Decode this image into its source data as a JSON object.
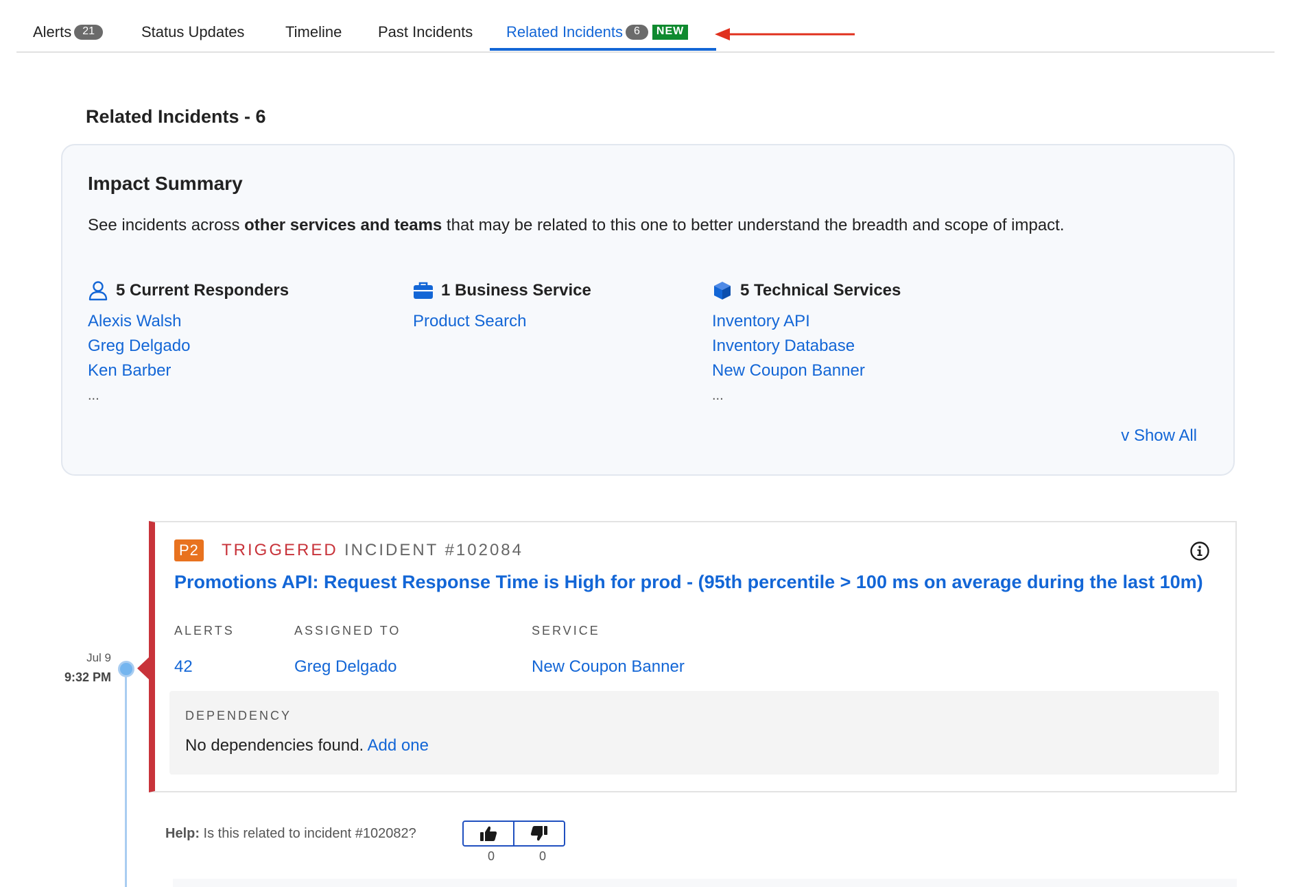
{
  "tabs": [
    {
      "label": "Alerts",
      "count": "21"
    },
    {
      "label": "Status Updates"
    },
    {
      "label": "Timeline"
    },
    {
      "label": "Past Incidents"
    },
    {
      "label": "Related Incidents",
      "count": "6",
      "badge": "NEW",
      "active": true
    }
  ],
  "colors": {
    "accent": "#1366d6",
    "triggered": "#c8333a",
    "priority": "#e8721f",
    "new_badge": "#0f8a2f",
    "annotation_arrow": "#e0301e"
  },
  "section": {
    "heading": "Related Incidents - 6"
  },
  "impact": {
    "title": "Impact Summary",
    "desc_pre": "See incidents across ",
    "desc_bold": "other services and teams",
    "desc_post": " that may be related to this one to better understand the breadth and scope of impact.",
    "responders": {
      "icon": "person-icon",
      "heading": "5 Current Responders",
      "items": [
        "Alexis Walsh",
        "Greg Delgado",
        "Ken Barber"
      ],
      "more": "..."
    },
    "business": {
      "icon": "briefcase-icon",
      "heading": "1 Business Service",
      "items": [
        "Product Search"
      ]
    },
    "technical": {
      "icon": "cube-icon",
      "heading": "5 Technical Services",
      "items": [
        "Inventory API",
        "Inventory Database",
        "New Coupon Banner"
      ],
      "more": "..."
    },
    "show_all": "v Show All"
  },
  "timeline": {
    "date": "Jul 9",
    "time": "9:32 PM"
  },
  "incident": {
    "priority": "P2",
    "status": "TRIGGERED",
    "number": "INCIDENT #102084",
    "title": "Promotions API: Request Response Time is High for prod - (95th percentile > 100 ms on average during the last 10m)",
    "fields": {
      "alerts_label": "ALERTS",
      "alerts_value": "42",
      "assigned_label": "ASSIGNED TO",
      "assigned_value": "Greg Delgado",
      "service_label": "SERVICE",
      "service_value": "New Coupon Banner"
    },
    "dependency": {
      "label": "DEPENDENCY",
      "text": "No dependencies found.",
      "link": "Add one"
    }
  },
  "feedback": {
    "prefix": "Help:",
    "question": " Is this related to incident #102082?",
    "up_count": "0",
    "down_count": "0"
  }
}
